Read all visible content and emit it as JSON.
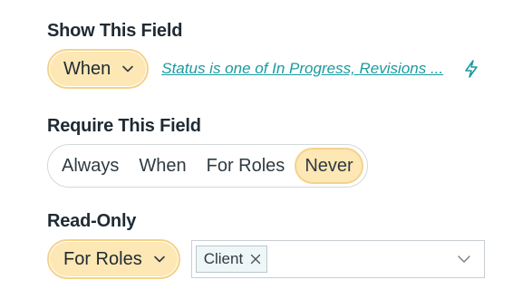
{
  "show_field": {
    "heading": "Show This Field",
    "selected": "When",
    "condition_text": "Status is one of In Progress, Revisions ...",
    "icons": {
      "dropdown": "chevron-down-icon",
      "action": "lightning-bolt-icon"
    }
  },
  "require_field": {
    "heading": "Require This Field",
    "options": [
      "Always",
      "When",
      "For Roles",
      "Never"
    ],
    "selected": "Never"
  },
  "read_only": {
    "heading": "Read-Only",
    "selected": "For Roles",
    "roles_tags": [
      "Client"
    ],
    "icons": {
      "dropdown": "chevron-down-icon",
      "remove": "close-icon"
    }
  },
  "colors": {
    "selected_fill": "#fde7b4",
    "selected_border": "#f4d28a",
    "link": "#1a9aa0",
    "text": "#1f2a33"
  }
}
